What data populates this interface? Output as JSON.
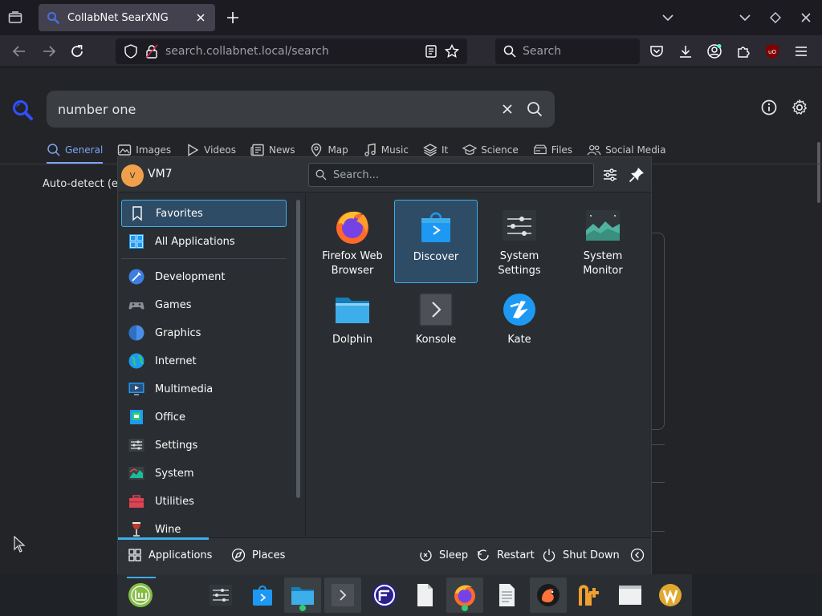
{
  "browser": {
    "tab_title": "CollabNet SearXNG",
    "url_host": "search.collabnet.local",
    "url_path": "/search",
    "search_placeholder": "Search"
  },
  "searx": {
    "query": "number one",
    "categories": [
      {
        "label": "General",
        "icon": "search-icon",
        "active": true
      },
      {
        "label": "Images",
        "icon": "image-icon"
      },
      {
        "label": "Videos",
        "icon": "play-icon"
      },
      {
        "label": "News",
        "icon": "newspaper-icon"
      },
      {
        "label": "Map",
        "icon": "map-pin-icon"
      },
      {
        "label": "Music",
        "icon": "music-icon"
      },
      {
        "label": "It",
        "icon": "layers-icon"
      },
      {
        "label": "Science",
        "icon": "graduation-icon"
      },
      {
        "label": "Files",
        "icon": "drive-icon"
      },
      {
        "label": "Social Media",
        "icon": "people-icon"
      }
    ],
    "auto_detect": "Auto-detect (en"
  },
  "launcher": {
    "user": "VM7",
    "avatar_initial": "V",
    "search_placeholder": "Search...",
    "categories": [
      {
        "label": "Favorites",
        "icon": "bookmark-icon",
        "selected": true
      },
      {
        "label": "All Applications",
        "icon": "grid-icon"
      },
      {
        "label": "Development",
        "icon": "development-icon"
      },
      {
        "label": "Games",
        "icon": "gamepad-icon"
      },
      {
        "label": "Graphics",
        "icon": "graphics-icon"
      },
      {
        "label": "Internet",
        "icon": "globe-icon"
      },
      {
        "label": "Multimedia",
        "icon": "monitor-icon"
      },
      {
        "label": "Office",
        "icon": "office-icon"
      },
      {
        "label": "Settings",
        "icon": "settings-icon"
      },
      {
        "label": "System",
        "icon": "system-icon"
      },
      {
        "label": "Utilities",
        "icon": "toolbox-icon"
      },
      {
        "label": "Wine",
        "icon": "wine-icon"
      }
    ],
    "apps": [
      {
        "label1": "Firefox Web",
        "label2": "Browser",
        "icon": "firefox-icon"
      },
      {
        "label1": "Discover",
        "label2": "",
        "icon": "discover-icon",
        "selected": true
      },
      {
        "label1": "System",
        "label2": "Settings",
        "icon": "system-settings-icon"
      },
      {
        "label1": "System",
        "label2": "Monitor",
        "icon": "system-monitor-icon"
      },
      {
        "label1": "Dolphin",
        "label2": "",
        "icon": "dolphin-folder-icon"
      },
      {
        "label1": "Konsole",
        "label2": "",
        "icon": "konsole-icon"
      },
      {
        "label1": "Kate",
        "label2": "",
        "icon": "kate-icon"
      }
    ],
    "footer": {
      "applications": "Applications",
      "places": "Places",
      "sleep": "Sleep",
      "restart": "Restart",
      "shutdown": "Shut Down"
    }
  },
  "colors": {
    "accent": "#3daee9",
    "selection": "#2f4c66",
    "searx_accent": "#7fa3f5"
  }
}
